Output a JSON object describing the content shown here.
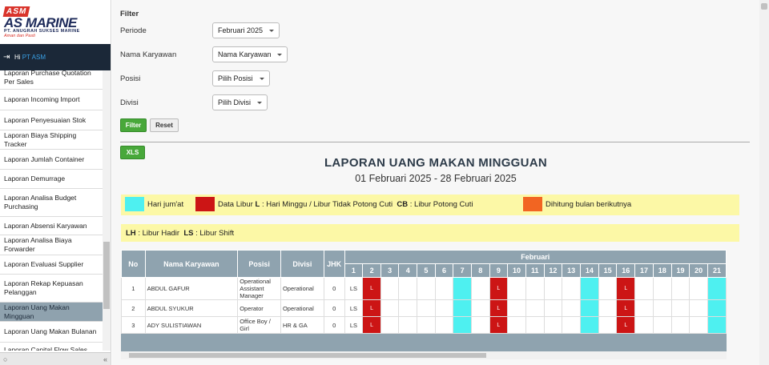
{
  "brand": {
    "mark": "ASM",
    "name": "AS MARINE",
    "subtitle": "PT. ANUGRAH SUKSES MARINE",
    "tagline": "Aman dan Pasti"
  },
  "user": {
    "greeting": "Hi",
    "name": "PT ASM"
  },
  "menu": [
    "Laporan Purchase Quotation Per Sales",
    "Laporan Incoming Import",
    "Laporan Penyesuaian Stok",
    "Laporan Biaya Shipping Tracker",
    "Laporan Jumlah Container",
    "Laporan Demurrage",
    "Laporan Analisa Budget Purchasing",
    "Laporan Absensi Karyawan",
    "Laporan Analisa Biaya Forwarder",
    "Laporan Evaluasi Supplier",
    "Laporan Rekap Kepuasan Pelanggan",
    "Laporan Uang Makan Mingguan",
    "Laporan Uang Makan Bulanan",
    "Laporan Capital Flow Sales"
  ],
  "active_menu": "Laporan Uang Makan Mingguan",
  "filter": {
    "heading": "Filter",
    "periode_label": "Periode",
    "periode_value": "Februari 2025",
    "karyawan_label": "Nama Karyawan",
    "karyawan_value": "Nama Karyawan",
    "posisi_label": "Posisi",
    "posisi_value": "Pilih Posisi",
    "divisi_label": "Divisi",
    "divisi_value": "Pilih Divisi",
    "filter_btn": "Filter",
    "reset_btn": "Reset"
  },
  "xls_btn": "XLS",
  "report": {
    "title": "LAPORAN UANG MAKAN MINGGUAN",
    "range": "01 Februari 2025 - 28 Februari 2025"
  },
  "legend": {
    "friday": "Hari jum'at",
    "libur_prefix": "Data Libur",
    "libur_code": "L",
    "libur_desc": ": Hari Minggu / Libur Tidak Potong Cuti",
    "cb_code": "CB",
    "cb_desc": ": Libur Potong Cuti",
    "next": "Dihitung bulan berikutnya",
    "lh_code": "LH",
    "lh_desc": ": Libur Hadir",
    "ls_code": "LS",
    "ls_desc": ": Libur Shift",
    "colors": {
      "friday": "#4ef0f0",
      "libur": "#cc1515",
      "next": "#f26522",
      "bg": "#fcf8a6"
    }
  },
  "table": {
    "headers": {
      "no": "No",
      "nama": "Nama Karyawan",
      "posisi": "Posisi",
      "divisi": "Divisi",
      "jhk": "JHK",
      "month": "Februari"
    },
    "days": [
      1,
      2,
      3,
      4,
      5,
      6,
      7,
      8,
      9,
      10,
      11,
      12,
      13,
      14,
      15,
      16,
      17,
      18,
      19,
      20,
      21
    ],
    "friday_days": [
      7,
      14,
      21
    ],
    "rows": [
      {
        "no": "1",
        "nama": "ABDUL GAFUR",
        "posisi": "Operational Assistant Manager",
        "divisi": "Operational",
        "jhk": "0",
        "day1": "LS",
        "libur": [
          2,
          9,
          16
        ],
        "libur_label": "L"
      },
      {
        "no": "2",
        "nama": "ABDUL SYUKUR",
        "posisi": "Operator",
        "divisi": "Operational",
        "jhk": "0",
        "day1": "LS",
        "libur": [
          2,
          9,
          16
        ],
        "libur_label": "L"
      },
      {
        "no": "3",
        "nama": "ADY SULISTIAWAN",
        "posisi": "Office Boy / Girl",
        "divisi": "HR & GA",
        "jhk": "0",
        "day1": "LS",
        "libur": [
          2,
          9,
          16
        ],
        "libur_label": "L"
      }
    ]
  }
}
